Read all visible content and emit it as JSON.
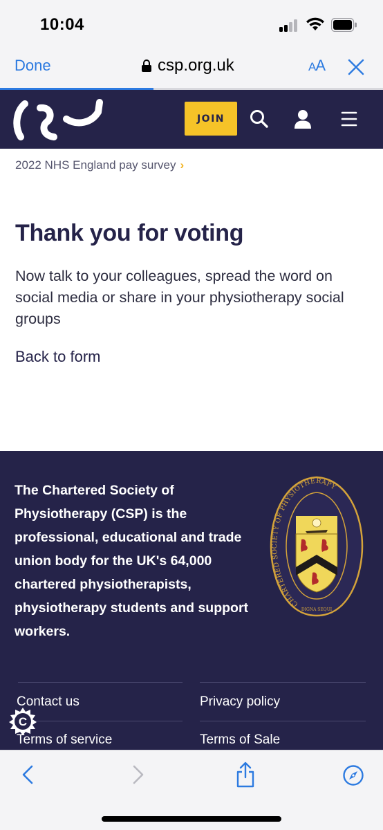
{
  "status_bar": {
    "time": "10:04"
  },
  "browser": {
    "done_label": "Done",
    "url": "csp.org.uk",
    "text_size_label_small": "A",
    "text_size_label_large": "A",
    "load_progress_fraction": 0.4,
    "accent_color": "#2c7ae0"
  },
  "site_header": {
    "background_color": "#252349",
    "join_label": "JOIN",
    "join_color": "#f6c328",
    "icons": [
      "search-icon",
      "user-icon",
      "menu-icon"
    ]
  },
  "breadcrumb": {
    "label": "2022 NHS England pay survey",
    "chevron": "›"
  },
  "main": {
    "title": "Thank you for voting",
    "body": "Now talk to your colleagues, spread the word on social media or share in your physiotherapy social groups",
    "back_link": "Back to form"
  },
  "footer": {
    "description": "The Chartered Society of Physiotherapy (CSP) is the professional, educational and trade union body for the UK's 64,000 chartered physiotherapists, physiotherapy students and support workers.",
    "links": {
      "contact": "Contact us",
      "privacy": "Privacy policy",
      "terms_service": "Terms of service",
      "terms_sale": "Terms of Sale"
    },
    "crest": {
      "ring_text": "CHARTERED SOCIETY OF PHYSIOTHERAPY",
      "motto": "DIGNA SEQUI"
    }
  },
  "cookie_badge": {
    "letter": "C"
  },
  "toolbar": {
    "icons": [
      "back-icon",
      "forward-icon",
      "share-icon",
      "compass-icon"
    ]
  }
}
